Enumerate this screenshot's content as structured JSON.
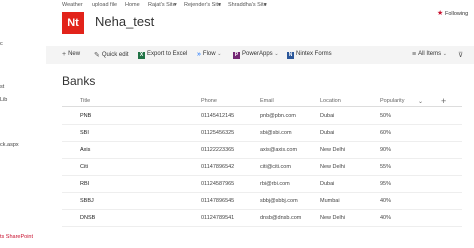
{
  "topnav": {
    "items": [
      "Weather",
      "upload file",
      "Home",
      "Rajat's Site",
      "Rejender's Site",
      "Shraddha's Site"
    ],
    "follow_label": "Following"
  },
  "sidebar": {
    "items": [
      "c",
      "st",
      "Lib",
      "ck.aspx",
      "ts SharePoint"
    ]
  },
  "site": {
    "logo_text": "Nt",
    "logo_color": "#e2231a",
    "title": "Neha_test"
  },
  "commands": {
    "new": "New",
    "quick_edit": "Quick edit",
    "export": "Export to Excel",
    "flow": "Flow",
    "powerapps": "PowerApps",
    "nintex": "Nintex Forms",
    "view": "All Items"
  },
  "list": {
    "title": "Banks",
    "columns": [
      "Title",
      "Phone",
      "Email",
      "Location",
      "Popularity"
    ],
    "rows": [
      {
        "title": "PNB",
        "phone": "01145412145",
        "email": "pnb@pbn.com",
        "location": "Dubai",
        "popularity": "50%"
      },
      {
        "title": "SBI",
        "phone": "01125456325",
        "email": "sbi@sbi.com",
        "location": "Dubai",
        "popularity": "60%"
      },
      {
        "title": "Axis",
        "phone": "01122223365",
        "email": "axis@axis.com",
        "location": "New Delhi",
        "popularity": "90%"
      },
      {
        "title": "Citi",
        "phone": "01147896542",
        "email": "citi@citi.com",
        "location": "New Delhi",
        "popularity": "55%"
      },
      {
        "title": "RBI",
        "phone": "01124587965",
        "email": "rbi@rbi.com",
        "location": "Dubai",
        "popularity": "95%"
      },
      {
        "title": "SBBJ",
        "phone": "01147896545",
        "email": "sbbj@sbbj.com",
        "location": "Mumbai",
        "popularity": "40%"
      },
      {
        "title": "DNSB",
        "phone": "01124789541",
        "email": "dnsb@dnsb.com",
        "location": "New Delhi",
        "popularity": "40%"
      }
    ]
  },
  "colors": {
    "accent": "#c8102e",
    "excel_green": "#217346",
    "flow_blue": "#0066ff",
    "powerapps_purple": "#742774",
    "nintex_blue": "#2b579a"
  }
}
